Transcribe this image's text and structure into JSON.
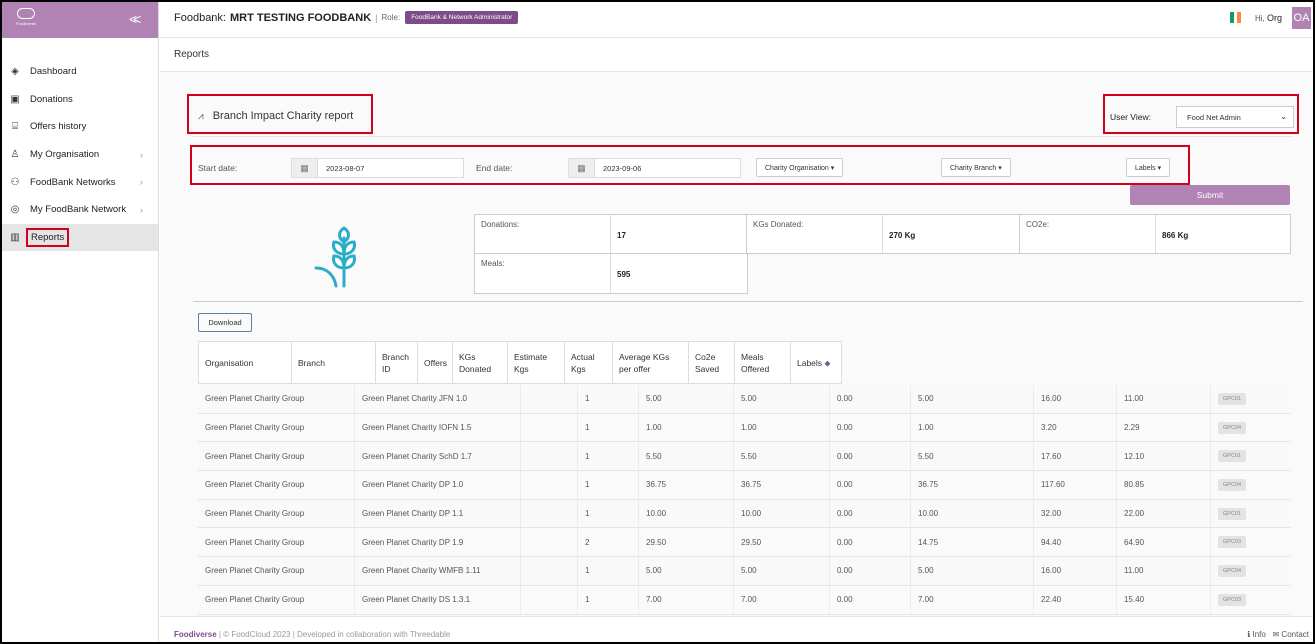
{
  "sidebar": {
    "logo_text": "Foodiverse",
    "collapse_icon": "double-chevron-left-icon",
    "items": [
      {
        "label": "Dashboard",
        "icon": "layers-icon",
        "chevron": false
      },
      {
        "label": "Donations",
        "icon": "box-icon",
        "chevron": false
      },
      {
        "label": "Offers history",
        "icon": "history-icon",
        "chevron": false
      },
      {
        "label": "My Organisation",
        "icon": "organisation-icon",
        "chevron": true
      },
      {
        "label": "FoodBank Networks",
        "icon": "network-icon",
        "chevron": true
      },
      {
        "label": "My FoodBank Network",
        "icon": "globe-icon",
        "chevron": true
      },
      {
        "label": "Reports",
        "icon": "bar-chart-icon",
        "chevron": false,
        "active": true
      }
    ]
  },
  "topbar": {
    "foodbank_label": "Foodbank:",
    "foodbank_name": "MRT TESTING FOODBANK",
    "separator": "|",
    "role_label": "Role:",
    "role_badge": "FoodBank & Network Administrator",
    "greeting": "Hi,",
    "user_name": "Org",
    "avatar_initials": "OA",
    "flag_colors": [
      "#169b62",
      "#ffffff",
      "#ff883e"
    ]
  },
  "page_header": "Reports",
  "report": {
    "title": "Branch Impact Charity report",
    "title_icon": "line-chart-icon",
    "user_view_label": "User View:",
    "user_view_value": "Food Net Admin"
  },
  "filters": {
    "start_date_label": "Start date:",
    "start_date": "2023-08-07",
    "end_date_label": "End date:",
    "end_date": "2023-09-06",
    "charity_org_dropdown": "Charity Organisation",
    "charity_branch_dropdown": "Charity Branch",
    "labels_dropdown": "Labels",
    "submit_label": "Submit"
  },
  "stats": {
    "donations_label": "Donations:",
    "donations_value": "17",
    "kgs_label": "KGs Donated:",
    "kgs_value": "270 Kg",
    "co2e_label": "CO2e:",
    "co2e_value": "866 Kg",
    "meals_label": "Meals:",
    "meals_value": "595"
  },
  "download_label": "Download",
  "table": {
    "headers": [
      "Organisation",
      "Branch",
      "Branch ID",
      "Offers",
      "KGs Donated",
      "Estimate Kgs",
      "Actual Kgs",
      "Average KGs per offer",
      "Co2e Saved",
      "Meals Offered",
      "Labels"
    ],
    "rows": [
      [
        "Green Planet Charity Group",
        "Green Planet Charity JFN 1.0",
        "",
        "1",
        "5.00",
        "5.00",
        "0.00",
        "5.00",
        "16.00",
        "11.00",
        "GPC01"
      ],
      [
        "Green Planet Charity Group",
        "Green Planet Charity IOFN 1.5",
        "",
        "1",
        "1.00",
        "1.00",
        "0.00",
        "1.00",
        "3.20",
        "2.29",
        "GPC04"
      ],
      [
        "Green Planet Charity Group",
        "Green Planet Charity SchD 1.7",
        "",
        "1",
        "5.50",
        "5.50",
        "0.00",
        "5.50",
        "17.60",
        "12.10",
        "GPC01"
      ],
      [
        "Green Planet Charity Group",
        "Green Planet Charity DP 1.0",
        "",
        "1",
        "36.75",
        "36.75",
        "0.00",
        "36.75",
        "117.60",
        "80.85",
        "GPC04"
      ],
      [
        "Green Planet Charity Group",
        "Green Planet Charity DP 1.1",
        "",
        "1",
        "10.00",
        "10.00",
        "0.00",
        "10.00",
        "32.00",
        "22.00",
        "GPC01"
      ],
      [
        "Green Planet Charity Group",
        "Green Planet Charity DP 1.9",
        "",
        "2",
        "29.50",
        "29.50",
        "0.00",
        "14.75",
        "94.40",
        "64.90",
        "GPC03"
      ],
      [
        "Green Planet Charity Group",
        "Green Planet Charity WMFB 1.11",
        "",
        "1",
        "5.00",
        "5.00",
        "0.00",
        "5.00",
        "16.00",
        "11.00",
        "GPC04"
      ],
      [
        "Green Planet Charity Group",
        "Green Planet Charity DS 1.3.1",
        "",
        "1",
        "7.00",
        "7.00",
        "0.00",
        "7.00",
        "22.40",
        "15.40",
        "GPC03"
      ]
    ]
  },
  "footer": {
    "brand": "Foodiverse",
    "text": "| © FoodCloud 2023 | Developed in collaboration with Threedable",
    "info": "Info",
    "contact": "Contact"
  }
}
